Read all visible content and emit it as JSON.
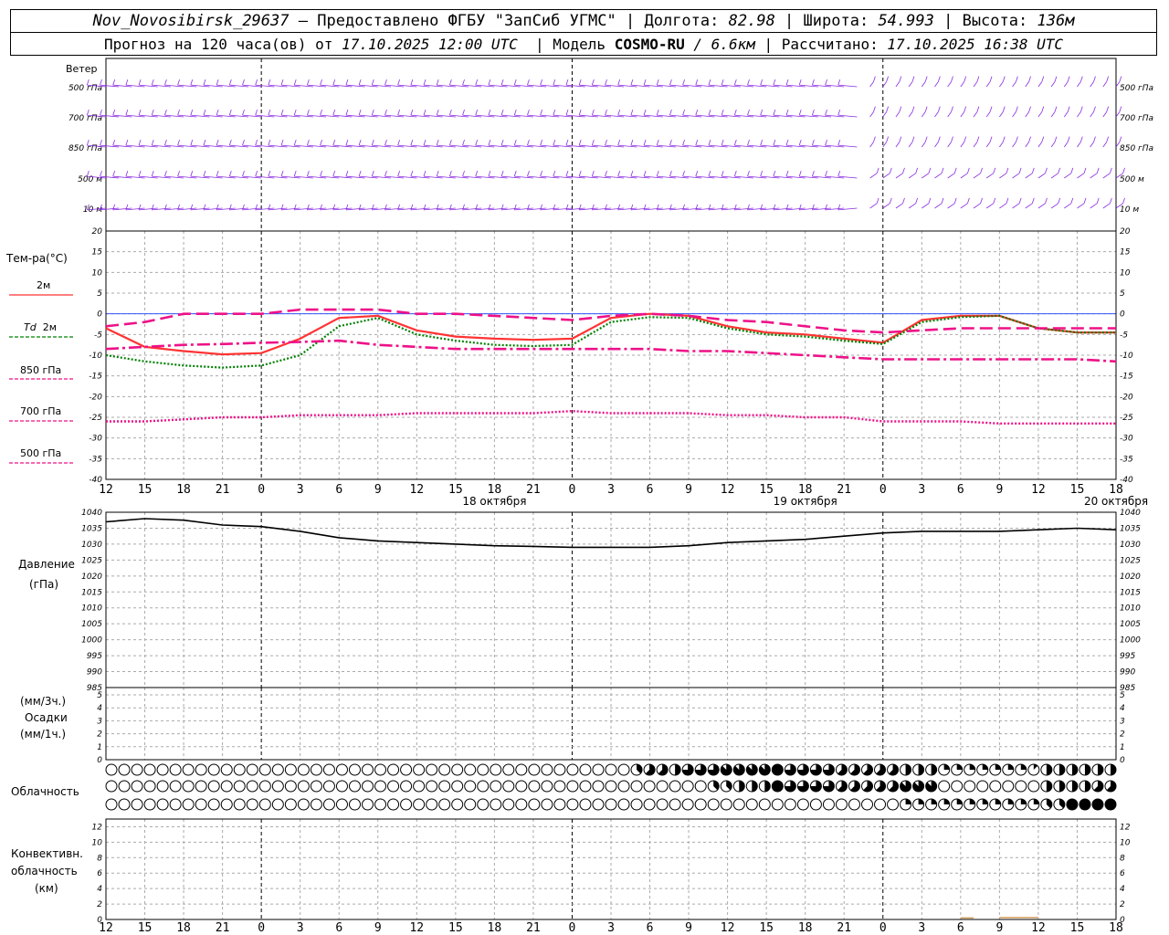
{
  "header": {
    "station": "Nov_Novosibirsk_29637",
    "dash": "—",
    "provider": "Предоставлено ФГБУ \"ЗапСиб УГМС\"",
    "lon_label": "Долгота:",
    "lon_value": "82.98",
    "lat_label": "Широта:",
    "lat_value": "54.993",
    "alt_label": "Высота:",
    "alt_value": "136м",
    "forecast_prefix": "Прогноз на 120 часа(ов) от",
    "forecast_start": "17.10.2025 12:00 UTC",
    "model_label": "Модель",
    "model_name": "COSMO-RU",
    "model_res": "/ 6.6км",
    "calc_label": "Рассчитано:",
    "calc_time": "17.10.2025 16:38 UTC"
  },
  "labels": {
    "wind": "Ветер",
    "temp": "Тем-ра(°С)",
    "t2m": "2м",
    "td": "Td",
    "td2m": "2м",
    "l850": "850 гПа",
    "l700": "700 гПа",
    "l500": "500 гПа",
    "pressure1": "Давление",
    "pressure2": "(гПа)",
    "precip1": "(мм/3ч.)",
    "precip2": "Осадки",
    "precip3": "(мм/1ч.)",
    "cloud": "Облачность",
    "conv1": "Конвективн.",
    "conv2": "облачность",
    "conv3": "(км)"
  },
  "colors": {
    "wind": "#8a2be2",
    "t2m": "#ff3333",
    "td2m": "#008000",
    "t850": "#ee1188",
    "t700": "#ee1188",
    "t500": "#ee1188",
    "pressure": "#000000",
    "conv": "#d4a060",
    "zero": "#3355ff"
  },
  "chart_data": {
    "type": "line",
    "time_axis": {
      "hour_labels": [
        "12",
        "15",
        "18",
        "21",
        "0",
        "3",
        "6",
        "9",
        "12",
        "15",
        "18",
        "21",
        "0",
        "3",
        "6",
        "9",
        "12",
        "15",
        "18",
        "21",
        "0",
        "3",
        "6",
        "9",
        "12",
        "15",
        "18"
      ],
      "day_labels": [
        {
          "hours_from_start": 42,
          "label": "18 октября"
        },
        {
          "hours_from_start": 66,
          "label": "19 октября"
        },
        {
          "hours_from_start": 90,
          "label": "20 октября"
        }
      ],
      "midnights": [
        12,
        36,
        60,
        84
      ],
      "range_hours": [
        0,
        78
      ]
    },
    "wind": {
      "levels": [
        "500 гПа",
        "700 гПа",
        "850 гПа",
        "500 м",
        "10 м"
      ]
    },
    "temperature": {
      "ylim": [
        -40,
        20
      ],
      "ticks": [
        20,
        15,
        10,
        5,
        0,
        -5,
        -10,
        -15,
        -20,
        -25,
        -30,
        -35,
        -40
      ],
      "series": [
        {
          "name": "2м",
          "key": "t2m",
          "x": [
            0,
            3,
            6,
            9,
            12,
            15,
            18,
            21,
            24,
            27,
            30,
            33,
            36,
            39,
            42,
            45,
            48,
            51,
            54,
            57,
            60,
            63,
            66,
            69,
            72,
            75,
            78
          ],
          "values": [
            -3.5,
            -8,
            -9,
            -9.8,
            -9.5,
            -6,
            -1,
            -0.5,
            -4,
            -5.5,
            -6,
            -6.3,
            -6,
            -1,
            0,
            -0.5,
            -3,
            -4.5,
            -5,
            -6,
            -7,
            -1.5,
            -0.5,
            -0.5,
            -3.5,
            -4.5,
            -4.5
          ]
        },
        {
          "name": "Td 2м",
          "key": "td2m",
          "x": [
            0,
            3,
            6,
            9,
            12,
            15,
            18,
            21,
            24,
            27,
            30,
            33,
            36,
            39,
            42,
            45,
            48,
            51,
            54,
            57,
            60,
            63,
            66,
            69,
            72,
            75,
            78
          ],
          "values": [
            -10,
            -11.5,
            -12.5,
            -13,
            -12.5,
            -10,
            -3,
            -1,
            -5,
            -6.5,
            -7.5,
            -7.8,
            -7.5,
            -2,
            -0.8,
            -1,
            -3.5,
            -5,
            -5.5,
            -6.5,
            -7.3,
            -2,
            -0.8,
            -0.5,
            -3.5,
            -4.5,
            -4.5
          ]
        },
        {
          "name": "850 гПа",
          "key": "t850",
          "x": [
            0,
            3,
            6,
            9,
            12,
            15,
            18,
            21,
            24,
            27,
            30,
            33,
            36,
            39,
            42,
            45,
            48,
            51,
            54,
            57,
            60,
            63,
            66,
            69,
            72,
            75,
            78
          ],
          "values": [
            -3,
            -2,
            0,
            0,
            0,
            1,
            1,
            1,
            0,
            0,
            -0.5,
            -1,
            -1.5,
            -0.5,
            0,
            -0.5,
            -1.5,
            -2,
            -3,
            -4,
            -4.5,
            -4,
            -3.5,
            -3.5,
            -3.5,
            -3.5,
            -3.5
          ]
        },
        {
          "name": "700 гПа",
          "key": "t700",
          "x": [
            0,
            3,
            6,
            9,
            12,
            15,
            18,
            21,
            24,
            27,
            30,
            33,
            36,
            39,
            42,
            45,
            48,
            51,
            54,
            57,
            60,
            63,
            66,
            69,
            72,
            75,
            78
          ],
          "values": [
            -8.5,
            -8,
            -7.5,
            -7.3,
            -7,
            -6.8,
            -6.5,
            -7.5,
            -8,
            -8.5,
            -8.5,
            -8.5,
            -8.5,
            -8.5,
            -8.5,
            -9,
            -9,
            -9.5,
            -10,
            -10.5,
            -11,
            -11,
            -11,
            -11,
            -11,
            -11,
            -11.5
          ]
        },
        {
          "name": "500 гПа",
          "key": "t500",
          "x": [
            0,
            3,
            6,
            9,
            12,
            15,
            18,
            21,
            24,
            27,
            30,
            33,
            36,
            39,
            42,
            45,
            48,
            51,
            54,
            57,
            60,
            63,
            66,
            69,
            72,
            75,
            78
          ],
          "values": [
            -26,
            -26,
            -25.5,
            -25,
            -25,
            -24.5,
            -24.5,
            -24.5,
            -24,
            -24,
            -24,
            -24,
            -23.5,
            -24,
            -24,
            -24,
            -24.5,
            -24.5,
            -25,
            -25,
            -26,
            -26,
            -26,
            -26.5,
            -26.5,
            -26.5,
            -26.5
          ]
        }
      ]
    },
    "pressure": {
      "ylim": [
        985,
        1040
      ],
      "ticks": [
        1040,
        1035,
        1030,
        1025,
        1020,
        1015,
        1010,
        1005,
        1000,
        995,
        990,
        985
      ],
      "x": [
        0,
        3,
        6,
        9,
        12,
        15,
        18,
        21,
        24,
        27,
        30,
        33,
        36,
        39,
        42,
        45,
        48,
        51,
        54,
        57,
        60,
        63,
        66,
        69,
        72,
        75,
        78
      ],
      "values": [
        1037,
        1038,
        1037.5,
        1036,
        1035.5,
        1034,
        1032,
        1031,
        1030.5,
        1030,
        1029.5,
        1029.3,
        1029,
        1029,
        1029,
        1029.5,
        1030.5,
        1031,
        1031.5,
        1032.5,
        1033.5,
        1034,
        1034,
        1034,
        1034.5,
        1035,
        1034.5
      ]
    },
    "precip": {
      "ylim": [
        0,
        5
      ],
      "ticks": [
        5,
        4,
        3,
        2,
        1,
        0
      ],
      "values": []
    },
    "cloud_cover": {
      "rows": [
        "high",
        "mid",
        "low"
      ],
      "count": 79,
      "x_start": 0,
      "x_step": 1,
      "high": [
        {
          "from": 0,
          "to": 40,
          "eighths": 0
        },
        {
          "from": 41,
          "to": 41,
          "eighths": 3
        },
        {
          "from": 42,
          "to": 43,
          "eighths": 5
        },
        {
          "from": 44,
          "to": 44,
          "eighths": 4
        },
        {
          "from": 45,
          "to": 47,
          "eighths": 6
        },
        {
          "from": 48,
          "to": 51,
          "eighths": 7
        },
        {
          "from": 52,
          "to": 52,
          "eighths": 8
        },
        {
          "from": 53,
          "to": 56,
          "eighths": 6
        },
        {
          "from": 57,
          "to": 61,
          "eighths": 5
        },
        {
          "from": 62,
          "to": 64,
          "eighths": 4
        },
        {
          "from": 65,
          "to": 71,
          "eighths": 2
        },
        {
          "from": 72,
          "to": 72,
          "eighths": 1
        },
        {
          "from": 73,
          "to": 78,
          "eighths": 4
        }
      ],
      "mid": [
        {
          "from": 0,
          "to": 46,
          "eighths": 0
        },
        {
          "from": 47,
          "to": 48,
          "eighths": 3
        },
        {
          "from": 49,
          "to": 51,
          "eighths": 4
        },
        {
          "from": 52,
          "to": 52,
          "eighths": 8
        },
        {
          "from": 53,
          "to": 56,
          "eighths": 6
        },
        {
          "from": 57,
          "to": 61,
          "eighths": 5
        },
        {
          "from": 62,
          "to": 64,
          "eighths": 7
        },
        {
          "from": 65,
          "to": 72,
          "eighths": 0
        },
        {
          "from": 73,
          "to": 76,
          "eighths": 4
        },
        {
          "from": 77,
          "to": 78,
          "eighths": 5
        }
      ],
      "low": [
        {
          "from": 0,
          "to": 61,
          "eighths": 0
        },
        {
          "from": 62,
          "to": 72,
          "eighths": 2
        },
        {
          "from": 73,
          "to": 74,
          "eighths": 3
        },
        {
          "from": 75,
          "to": 78,
          "eighths": 8
        }
      ]
    },
    "convective": {
      "ylim": [
        0,
        13
      ],
      "ticks": [
        12,
        10,
        8,
        6,
        4,
        2,
        0
      ],
      "segments": [
        {
          "from": 66,
          "to": 67,
          "top": 0.2
        },
        {
          "from": 69,
          "to": 72,
          "top": 0.25
        }
      ]
    }
  }
}
